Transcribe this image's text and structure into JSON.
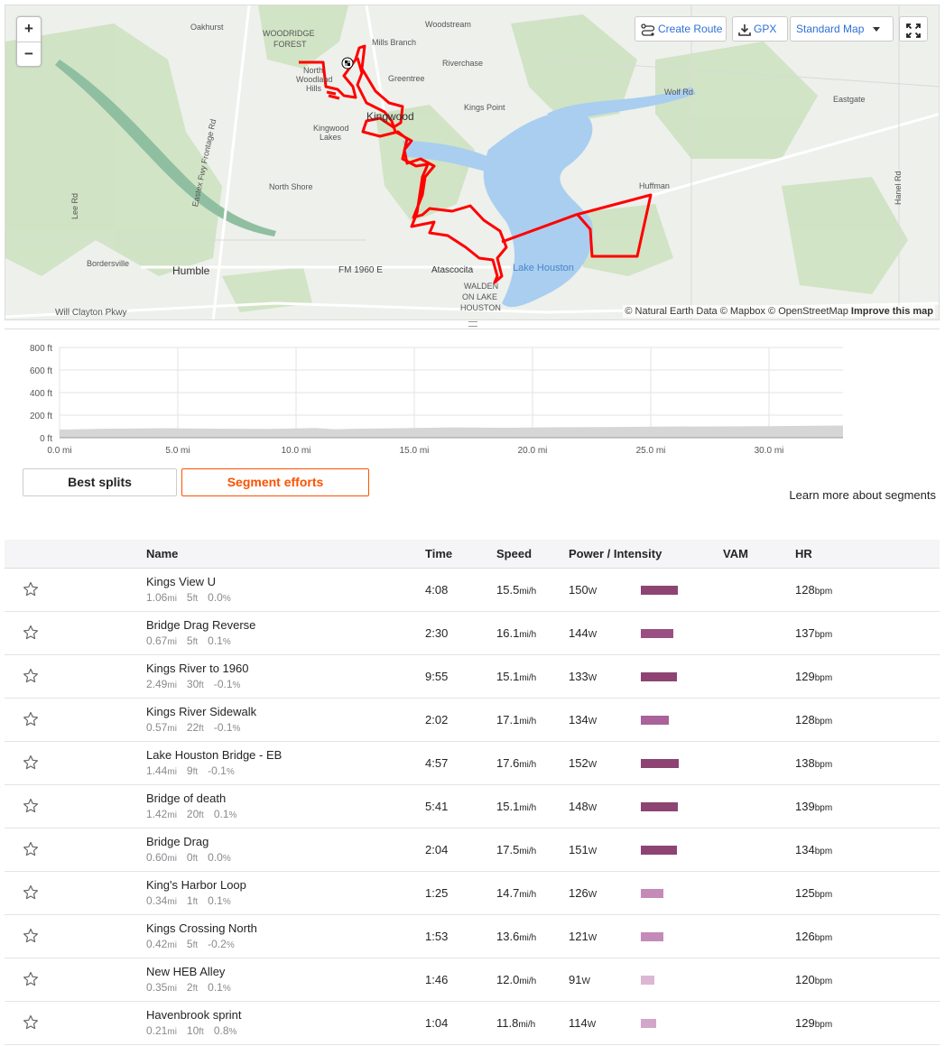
{
  "map": {
    "zoom_in": "+",
    "zoom_out": "−",
    "create_route": "Create Route",
    "gpx": "GPX",
    "map_style": "Standard Map",
    "attribution": "© Natural Earth Data © Mapbox © OpenStreetMap",
    "improve": "Improve this map",
    "labels": {
      "oakhurst": "Oakhurst",
      "woodridge": "WOODRIDGE",
      "forest": "FOREST",
      "woodstream": "Woodstream",
      "mills_branch": "Mills Branch",
      "riverchase": "Riverchase",
      "north": "North",
      "woodland": "Woodland",
      "hills": "Hills",
      "greentree": "Greentree",
      "kingwood": "Kingwood",
      "kings_point": "Kings Point",
      "wolf_rd": "Wolf Rd",
      "eastgate": "Eastgate",
      "kingwood_lakes_1": "Kingwood",
      "kingwood_lakes_2": "Lakes",
      "eastex": "Eastex Fwy Frontage Rd",
      "north_shore": "North Shore",
      "huffman": "Huffman",
      "lee_rd": "Lee Rd",
      "hanel_rd": "Hanel Rd",
      "bordersville": "Bordersville",
      "humble": "Humble",
      "fm1960": "FM 1960 E",
      "atascocita": "Atascocita",
      "lake_houston": "Lake Houston",
      "walden_1": "WALDEN",
      "walden_2": "ON LAKE",
      "walden_3": "HOUSTON",
      "will_clayton": "Will Clayton Pkwy"
    }
  },
  "elevation": {
    "y_ticks": [
      "800 ft",
      "600 ft",
      "400 ft",
      "200 ft",
      "0 ft"
    ],
    "x_ticks": [
      "0.0 mi",
      "5.0 mi",
      "10.0 mi",
      "15.0 mi",
      "20.0 mi",
      "25.0 mi",
      "30.0 mi"
    ]
  },
  "tabs": {
    "best_splits": "Best splits",
    "segment_efforts": "Segment efforts"
  },
  "learn_more": "Learn more about segments",
  "table": {
    "headers": {
      "name": "Name",
      "time": "Time",
      "speed": "Speed",
      "power": "Power / Intensity",
      "vam": "VAM",
      "hr": "HR"
    },
    "units": {
      "dist": "mi",
      "elev": "ft",
      "grade": "%",
      "speed": "mi/h",
      "power": "W",
      "hr": "bpm"
    },
    "rows": [
      {
        "name": "Kings View U",
        "dist": "1.06",
        "elev": "5",
        "grade": "0.0",
        "time": "4:08",
        "speed": "15.5",
        "power": "150",
        "hr": "128",
        "intensity": 0.82,
        "color": "#8d4473"
      },
      {
        "name": "Bridge Drag Reverse",
        "dist": "0.67",
        "elev": "5",
        "grade": "0.1",
        "time": "2:30",
        "speed": "16.1",
        "power": "144",
        "hr": "137",
        "intensity": 0.72,
        "color": "#9a4f82"
      },
      {
        "name": "Kings River to 1960",
        "dist": "2.49",
        "elev": "30",
        "grade": "-0.1",
        "time": "9:55",
        "speed": "15.1",
        "power": "133",
        "hr": "129",
        "intensity": 0.8,
        "color": "#8d4473"
      },
      {
        "name": "Kings River Sidewalk",
        "dist": "0.57",
        "elev": "22",
        "grade": "-0.1",
        "time": "2:02",
        "speed": "17.1",
        "power": "134",
        "hr": "128",
        "intensity": 0.62,
        "color": "#a9629a"
      },
      {
        "name": "Lake Houston Bridge - EB",
        "dist": "1.44",
        "elev": "9",
        "grade": "-0.1",
        "time": "4:57",
        "speed": "17.6",
        "power": "152",
        "hr": "138",
        "intensity": 0.84,
        "color": "#8d4473"
      },
      {
        "name": "Bridge of death",
        "dist": "1.42",
        "elev": "20",
        "grade": "0.1",
        "time": "5:41",
        "speed": "15.1",
        "power": "148",
        "hr": "139",
        "intensity": 0.82,
        "color": "#8d4473"
      },
      {
        "name": "Bridge Drag",
        "dist": "0.60",
        "elev": "0",
        "grade": "0.0",
        "time": "2:04",
        "speed": "17.5",
        "power": "151",
        "hr": "134",
        "intensity": 0.8,
        "color": "#8d4473"
      },
      {
        "name": "King's Harbor Loop",
        "dist": "0.34",
        "elev": "1",
        "grade": "0.1",
        "time": "1:25",
        "speed": "14.7",
        "power": "126",
        "hr": "125",
        "intensity": 0.5,
        "color": "#c48ab8"
      },
      {
        "name": "Kings Crossing North",
        "dist": "0.42",
        "elev": "5",
        "grade": "-0.2",
        "time": "1:53",
        "speed": "13.6",
        "power": "121",
        "hr": "126",
        "intensity": 0.5,
        "color": "#c48ab8"
      },
      {
        "name": "New HEB Alley",
        "dist": "0.35",
        "elev": "2",
        "grade": "0.1",
        "time": "1:46",
        "speed": "12.0",
        "power": "91",
        "hr": "120",
        "intensity": 0.3,
        "color": "#dcb7d4"
      },
      {
        "name": "Havenbrook sprint",
        "dist": "0.21",
        "elev": "10",
        "grade": "0.8",
        "time": "1:04",
        "speed": "11.8",
        "power": "114",
        "hr": "129",
        "intensity": 0.34,
        "color": "#d1a6c8"
      }
    ]
  }
}
